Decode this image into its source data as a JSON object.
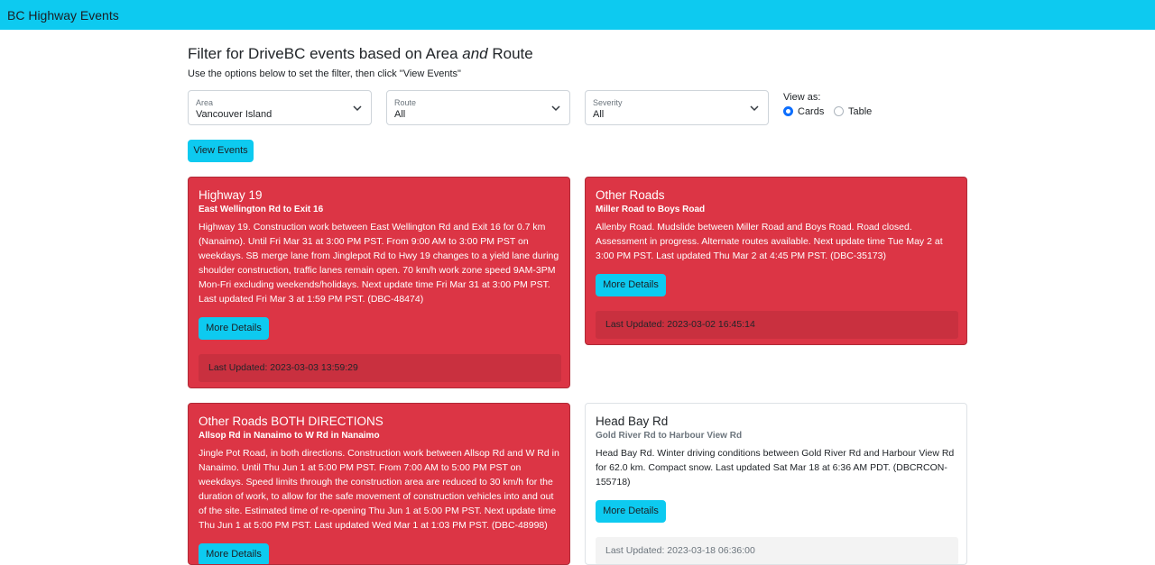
{
  "navbar": {
    "brand": "BC Highway Events"
  },
  "filter": {
    "heading_before": "Filter for DriveBC events based on Area ",
    "heading_em": "and",
    "heading_after": " Route",
    "subtext": "Use the options below to set the filter, then click \"View Events\"",
    "area": {
      "label": "Area",
      "value": "Vancouver Island"
    },
    "route": {
      "label": "Route",
      "value": "All"
    },
    "severity": {
      "label": "Severity",
      "value": "All"
    },
    "view_as": {
      "label": "View as:",
      "options": [
        "Cards",
        "Table"
      ],
      "selected": "Cards"
    },
    "submit_label": "View Events"
  },
  "cards": [
    {
      "title": "Highway 19",
      "subtitle": "East Wellington Rd to Exit 16",
      "body": "Highway 19. Construction work between East Wellington Rd and Exit 16 for 0.7 km (Nanaimo). Until Fri Mar 31 at 3:00 PM PST. From 9:00 AM to 3:00 PM PST on weekdays. SB merge lane from Jinglepot Rd to Hwy 19 changes to a yield lane during shoulder construction, traffic lanes remain open. 70 km/h work zone speed 9AM-3PM Mon-Fri excluding weekends/holidays. Next update time Fri Mar 31 at 3:00 PM PST. Last updated Fri Mar 3 at 1:59 PM PST. (DBC-48474)",
      "button": "More Details",
      "footer": "Last Updated: 2023-03-03 13:59:29",
      "style": "danger"
    },
    {
      "title": "Other Roads",
      "subtitle": "Miller Road to Boys Road",
      "body": "Allenby Road. Mudslide between Miller Road and Boys Road. Road closed. Assessment in progress. Alternate routes available. Next update time Tue May 2 at 3:00 PM PST. Last updated Thu Mar 2 at 4:45 PM PST. (DBC-35173)",
      "button": "More Details",
      "footer": "Last Updated: 2023-03-02 16:45:14",
      "style": "danger"
    },
    {
      "title": "Other Roads BOTH DIRECTIONS",
      "subtitle": "Allsop Rd in Nanaimo to W Rd in Nanaimo",
      "body": "Jingle Pot Road, in both directions. Construction work between Allsop Rd and W Rd in Nanaimo. Until Thu Jun 1 at 5:00 PM PST. From 7:00 AM to 5:00 PM PST on weekdays. Speed limits through the construction area are reduced to 30 km/h for the duration of work, to allow for the safe movement of construction vehicles into and out of the site. Estimated time of re-opening Thu Jun 1 at 5:00 PM PST. Next update time Thu Jun 1 at 5:00 PM PST. Last updated Wed Mar 1 at 1:03 PM PST. (DBC-48998)",
      "button": "More Details",
      "footer": "",
      "style": "danger"
    },
    {
      "title": "Head Bay Rd",
      "subtitle": "Gold River Rd to Harbour View Rd",
      "body": "Head Bay Rd. Winter driving conditions between Gold River Rd and Harbour View Rd for 62.0 km. Compact snow. Last updated Sat Mar 18 at 6:36 AM PDT. (DBCRCON-155718)",
      "button": "More Details",
      "footer": "Last Updated: 2023-03-18 06:36:00",
      "style": "light"
    }
  ],
  "colors": {
    "navbar": "#0dcaf0",
    "danger": "#dc3545",
    "info_button": "#0dcaf0",
    "radio_selected": "#0d6efd"
  }
}
